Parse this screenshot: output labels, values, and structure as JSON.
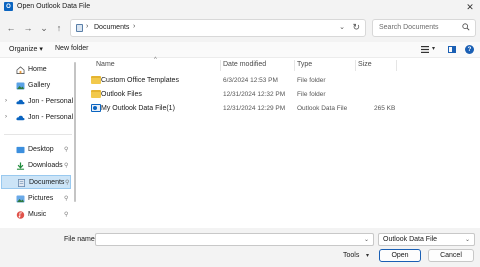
{
  "window": {
    "title": "Open Outlook Data File",
    "close_glyph": "✕"
  },
  "nav": {
    "back": "←",
    "forward": "→",
    "recent": "⌄",
    "up": "↑",
    "address": {
      "crumb": "Documents",
      "separator": "›"
    },
    "search": {
      "placeholder": "Search Documents"
    }
  },
  "commands": {
    "organize": "Organize ▾",
    "new_folder": "New folder"
  },
  "sidebar": {
    "items": [
      {
        "label": "Home",
        "icon": "home-icon"
      },
      {
        "label": "Gallery",
        "icon": "gallery-icon"
      },
      {
        "label": "Jon - Personal",
        "icon": "onedrive-icon"
      },
      {
        "label": "Jon - Personal",
        "icon": "onedrive-icon"
      },
      {
        "label": "Desktop",
        "icon": "desktop-icon"
      },
      {
        "label": "Downloads",
        "icon": "download-icon"
      },
      {
        "label": "Documents",
        "icon": "documents-icon"
      },
      {
        "label": "Pictures",
        "icon": "pictures-icon"
      },
      {
        "label": "Music",
        "icon": "music-icon"
      }
    ]
  },
  "columns": [
    "Name",
    "Date modified",
    "Type",
    "Size"
  ],
  "files": [
    {
      "name": "Custom Office Templates",
      "date": "6/3/2024 12:53 PM",
      "type": "File folder",
      "size": "",
      "icon": "folder-icon"
    },
    {
      "name": "Outlook Files",
      "date": "12/31/2024 12:32 PM",
      "type": "File folder",
      "size": "",
      "icon": "folder-icon"
    },
    {
      "name": "My Outlook Data File(1)",
      "date": "12/31/2024 12:29 PM",
      "type": "Outlook Data File",
      "size": "265 KB",
      "icon": "pst-file-icon"
    }
  ],
  "footer": {
    "file_name_label": "File name:",
    "file_name_value": "",
    "file_type": "Outlook Data File",
    "tools": "Tools",
    "open": "Open",
    "cancel": "Cancel"
  },
  "colors": {
    "accent": "#1a5fb4",
    "selection": "#cce4f7",
    "folder": "#f2c94c"
  }
}
